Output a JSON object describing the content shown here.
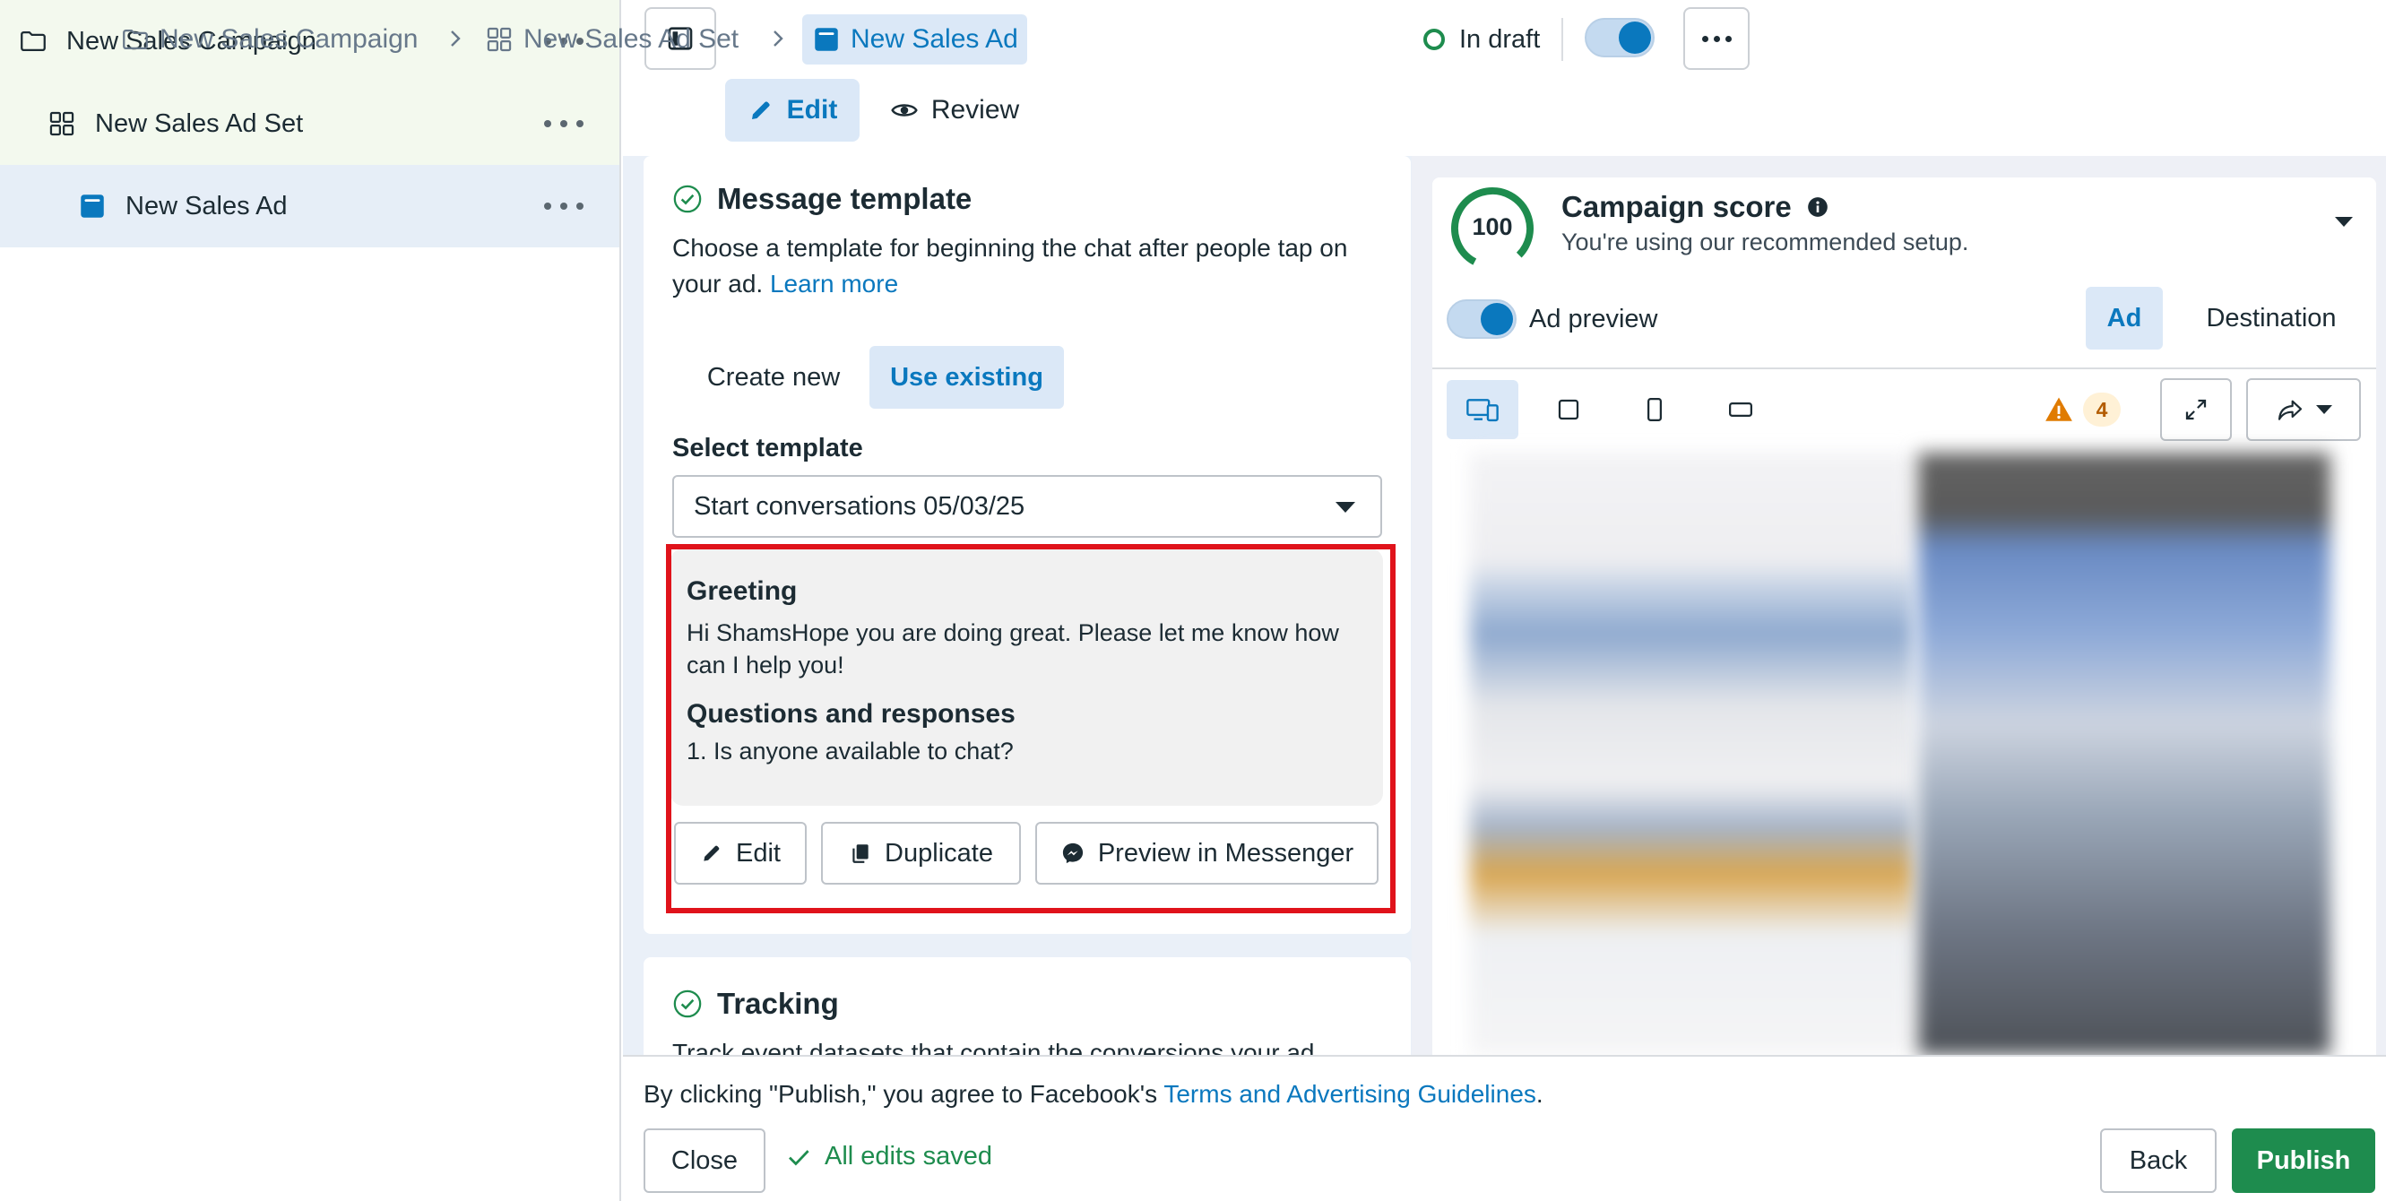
{
  "sidebar": {
    "items": [
      {
        "label": "New Sales Campaign",
        "icon": "folder-icon"
      },
      {
        "label": "New Sales Ad Set",
        "icon": "grid-icon"
      },
      {
        "label": "New Sales Ad",
        "icon": "ad-icon"
      }
    ]
  },
  "breadcrumb": {
    "campaign": "New Sales Campaign",
    "adset": "New Sales Ad Set",
    "ad": "New Sales Ad"
  },
  "header": {
    "status": "In draft",
    "mode_edit": "Edit",
    "mode_review": "Review"
  },
  "message_template": {
    "title": "Message template",
    "description": "Choose a template for beginning the chat after people tap on your ad.",
    "learn_more": "Learn more",
    "tab_create": "Create new",
    "tab_existing": "Use existing",
    "select_label": "Select template",
    "selected_template": "Start conversations 05/03/25",
    "greeting_title": "Greeting",
    "greeting_text": "Hi ShamsHope you are doing great. Please let me know how can I help you!",
    "qa_title": "Questions and responses",
    "qa_item": "1. Is anyone available to chat?",
    "btn_edit": "Edit",
    "btn_duplicate": "Duplicate",
    "btn_preview": "Preview in Messenger"
  },
  "tracking": {
    "title": "Tracking",
    "description": "Track event datasets that contain the conversions your ad"
  },
  "campaign_score": {
    "score": "100",
    "title": "Campaign score",
    "description": "You're using our recommended setup."
  },
  "ad_preview": {
    "label": "Ad preview",
    "tab_ad": "Ad",
    "tab_destination": "Destination",
    "warning_count": "4"
  },
  "footer": {
    "terms_prefix": "By clicking \"Publish,\" you agree to Facebook's ",
    "terms_link": "Terms and Advertising Guidelines",
    "terms_suffix": ".",
    "close": "Close",
    "saved": "All edits saved",
    "back": "Back",
    "publish": "Publish"
  },
  "colors": {
    "accent_blue": "#0a78be",
    "success_green": "#1e8c4e",
    "highlight_red": "#e0131b",
    "selected_bg": "#dbe8f7"
  }
}
